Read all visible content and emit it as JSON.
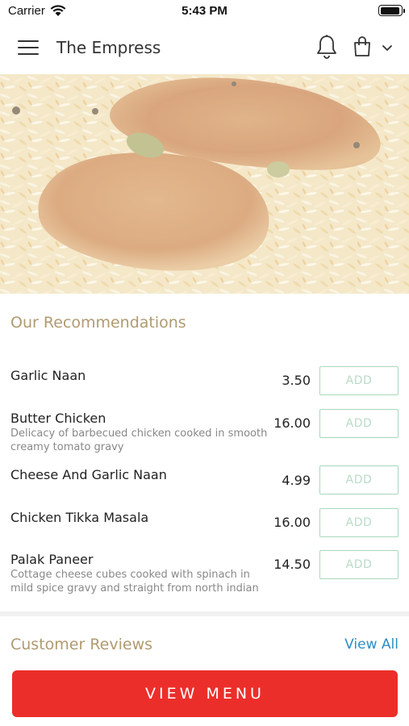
{
  "status_bar": {
    "carrier": "Carrier",
    "time": "5:43 PM",
    "battery_level": 0.95
  },
  "header": {
    "title": "The Empress",
    "icons": [
      "menu-icon",
      "bell-icon",
      "shopping-bag-icon",
      "chevron-down-icon"
    ]
  },
  "recommendations": {
    "title": "Our Recommendations",
    "add_label": "ADD",
    "items": [
      {
        "name": "Garlic Naan",
        "description": "",
        "price": "3.50"
      },
      {
        "name": "Butter Chicken",
        "description": "Delicacy of barbecued chicken cooked in smooth creamy tomato gravy",
        "price": "16.00"
      },
      {
        "name": "Cheese And Garlic Naan",
        "description": "",
        "price": "4.99"
      },
      {
        "name": "Chicken Tikka Masala",
        "description": "",
        "price": "16.00"
      },
      {
        "name": "Palak Paneer",
        "description": "Cottage cheese cubes cooked with spinach in mild spice gravy and straight from north indian",
        "price": "14.50"
      }
    ]
  },
  "reviews": {
    "title": "Customer Reviews",
    "view_all_label": "View All"
  },
  "footer": {
    "view_menu_label": "VIEW MENU"
  },
  "colors": {
    "accent_red": "#ec2e2a",
    "section_title": "#b09a70",
    "link_blue": "#2b8fc4",
    "add_border": "#a9d8bc"
  }
}
